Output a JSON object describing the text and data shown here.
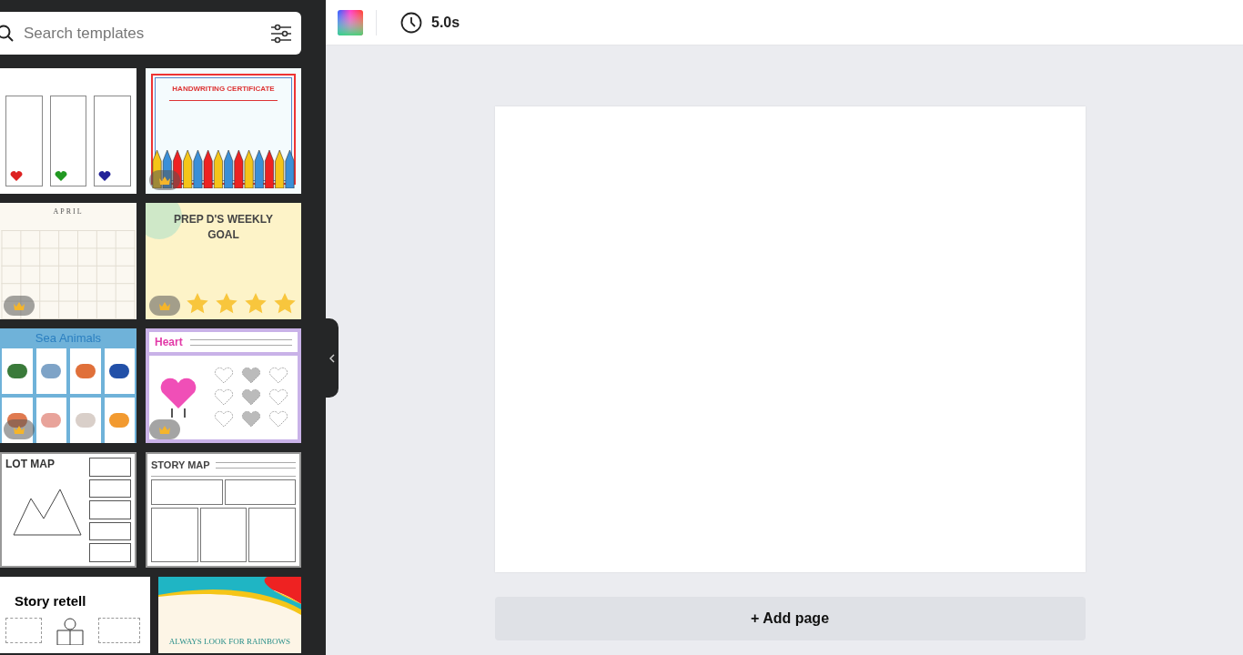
{
  "sidebar": {
    "search": {
      "placeholder": "Search templates"
    },
    "templates": [
      {
        "kind": "reading-log",
        "premium": false
      },
      {
        "kind": "certificate",
        "title": "HANDWRITING CERTIFICATE",
        "premium": true
      },
      {
        "kind": "calendar",
        "title": "APRIL",
        "premium": true
      },
      {
        "kind": "goal",
        "title": "PREP D'S WEEKLY GOAL",
        "premium": true
      },
      {
        "kind": "cards",
        "title": "Sea Animals",
        "premium": true
      },
      {
        "kind": "worksheet",
        "title": "Heart",
        "premium": true
      },
      {
        "kind": "map",
        "title": "LOT MAP",
        "premium": false
      },
      {
        "kind": "story-map",
        "title": "STORY MAP",
        "premium": false
      },
      {
        "kind": "retell",
        "title": "Story retell",
        "premium": false
      },
      {
        "kind": "rainbow",
        "title": "ALWAYS LOOK FOR RAINBOWS",
        "premium": false
      }
    ]
  },
  "toolbar": {
    "duration": "5.0s"
  },
  "canvas": {
    "add_page": "+ Add page"
  }
}
